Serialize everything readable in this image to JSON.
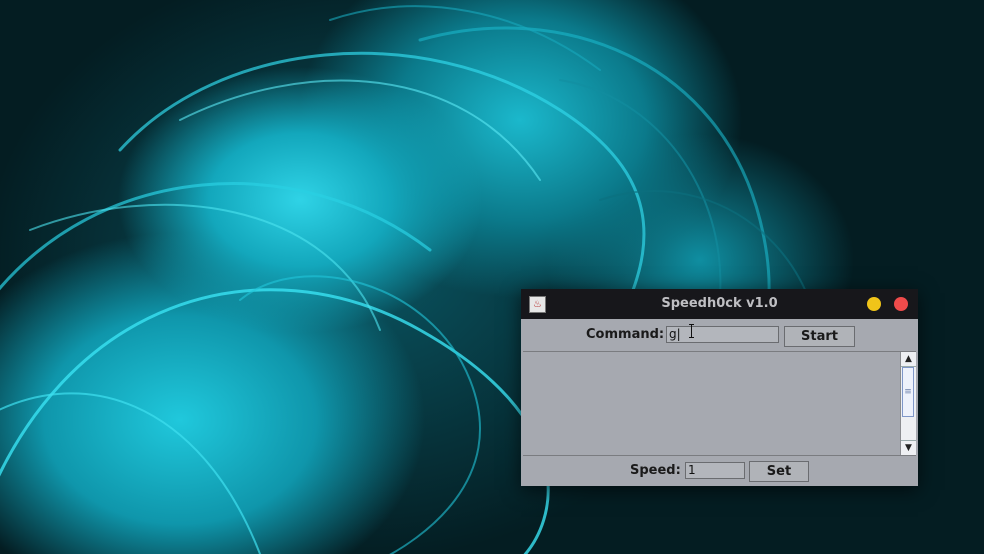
{
  "desktop": {
    "wallpaper_colors": [
      "#2fd3e6",
      "#0f96ab",
      "#02141a"
    ]
  },
  "window": {
    "title": "Speedh0ck v1.0",
    "icon": "java-app-icon",
    "controls": {
      "minimize_color": "#f0c419",
      "close_color": "#ef4b4b"
    }
  },
  "command": {
    "label": "Command:",
    "value": "g|",
    "start_label": "Start"
  },
  "output": {
    "text": "",
    "scroll_up_icon": "▲",
    "scroll_down_icon": "▼",
    "thumb_grip": "≡"
  },
  "speed": {
    "label": "Speed:",
    "value": "1",
    "set_label": "Set"
  }
}
